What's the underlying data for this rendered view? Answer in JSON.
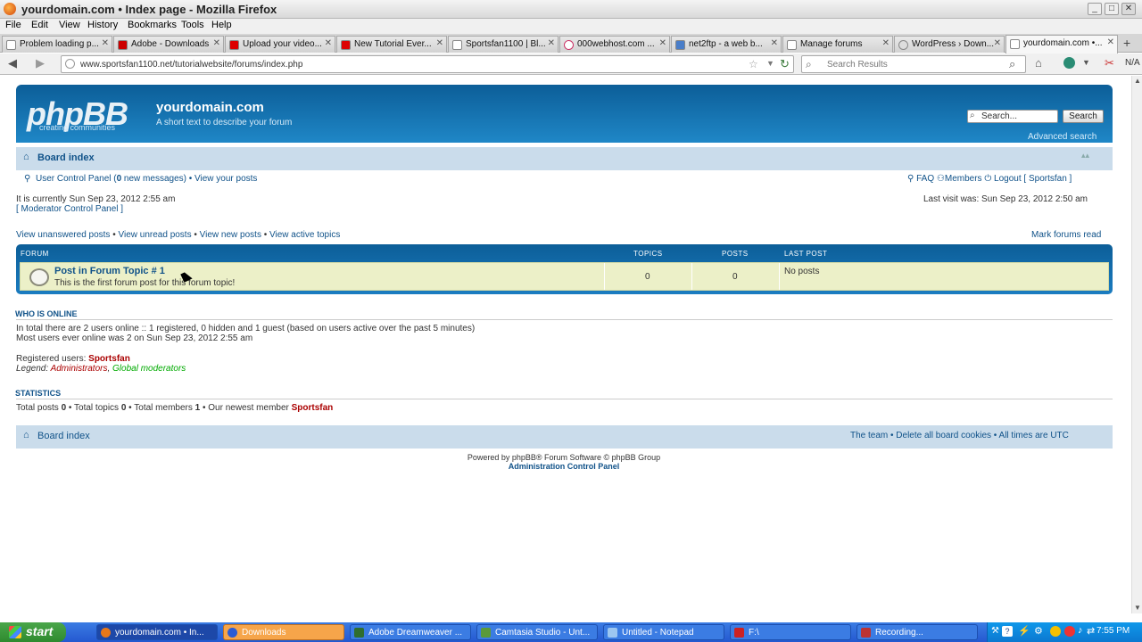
{
  "window": {
    "title": "yourdomain.com • Index page - Mozilla Firefox",
    "min": "_",
    "max": "□",
    "close": "✕"
  },
  "menu": [
    "File",
    "Edit",
    "View",
    "History",
    "Bookmarks",
    "Tools",
    "Help"
  ],
  "tabs": [
    {
      "label": "Problem loading p..."
    },
    {
      "label": "Adobe - Downloads"
    },
    {
      "label": "Upload your video..."
    },
    {
      "label": "New Tutorial Ever..."
    },
    {
      "label": "Sportsfan1100 | Bl..."
    },
    {
      "label": "000webhost.com ..."
    },
    {
      "label": "net2ftp - a web b..."
    },
    {
      "label": "Manage forums"
    },
    {
      "label": "WordPress › Down..."
    },
    {
      "label": "yourdomain.com •..."
    }
  ],
  "nav": {
    "url": "www.sportsfan1100.net/tutorialwebsite/forums/index.php",
    "search_placeholder": "Search Results",
    "zone": "N/A"
  },
  "forum": {
    "logo": "phpBB",
    "logo_sub": "creating  communities",
    "site_name": "yourdomain.com",
    "site_desc": "A short text to describe your forum",
    "search_placeholder": "Search...",
    "search_button": "Search",
    "advanced_search": "Advanced search",
    "board_index": "Board index",
    "user_cp": "User Control Panel (",
    "new_messages_count": "0",
    "new_messages_tail": " new messages) •",
    "view_your_posts": "View your posts",
    "faq": "FAQ",
    "members": "Members",
    "logout": "Logout [ Sportsfan ]",
    "current_time": "It is currently Sun Sep 23, 2012 2:55 am",
    "last_visit": "Last visit was: Sun Sep 23, 2012 2:50 am",
    "mod_cp": "[ Moderator Control Panel ]",
    "view_links": [
      "View unanswered posts",
      "View unread posts",
      "View new posts",
      "View active topics"
    ],
    "mark_read": "Mark forums read",
    "table_headers": {
      "forum": "FORUM",
      "topics": "TOPICS",
      "posts": "POSTS",
      "last_post": "LAST POST"
    },
    "row": {
      "title": "Post in Forum Topic # 1",
      "desc": "This is the first forum post for this forum topic!",
      "topics": "0",
      "posts": "0",
      "last_post": "No posts"
    },
    "who_online_title": "WHO IS ONLINE",
    "online_line1": "In total there are 2 users online :: 1 registered, 0 hidden and 1 guest (based on users active over the past 5 minutes)",
    "online_line2": "Most users ever online was 2 on Sun Sep 23, 2012 2:55 am",
    "registered_label": "Registered users: ",
    "registered_user": "Sportsfan",
    "legend_label": "Legend: ",
    "legend_admin": "Administrators",
    "legend_mod": "Global moderators",
    "stats_title": "STATISTICS",
    "stats_a": "Total posts ",
    "stats_posts": "0",
    "stats_b": " • Total topics ",
    "stats_topics": "0",
    "stats_c": " • Total members ",
    "stats_members": "1",
    "stats_d": " • Our newest member ",
    "stats_newest": "Sportsfan",
    "footer_links": "The team • Delete all board cookies • All times are UTC",
    "powered": "Powered by phpBB® Forum Software © phpBB Group",
    "admin_cp": "Administration Control Panel"
  },
  "taskbar": {
    "start": "start",
    "items": [
      {
        "label": "yourdomain.com • In..."
      },
      {
        "label": "Downloads"
      },
      {
        "label": "Adobe Dreamweaver ..."
      },
      {
        "label": "Camtasia Studio - Unt..."
      },
      {
        "label": "Untitled - Notepad"
      },
      {
        "label": "F:\\"
      },
      {
        "label": "Recording..."
      }
    ],
    "clock": "7:55 PM"
  },
  "colors": {
    "header_blue": "#105289",
    "row_bg": "#ecf0c8",
    "admin_red": "#aa0000",
    "mod_green": "#00aa00"
  }
}
